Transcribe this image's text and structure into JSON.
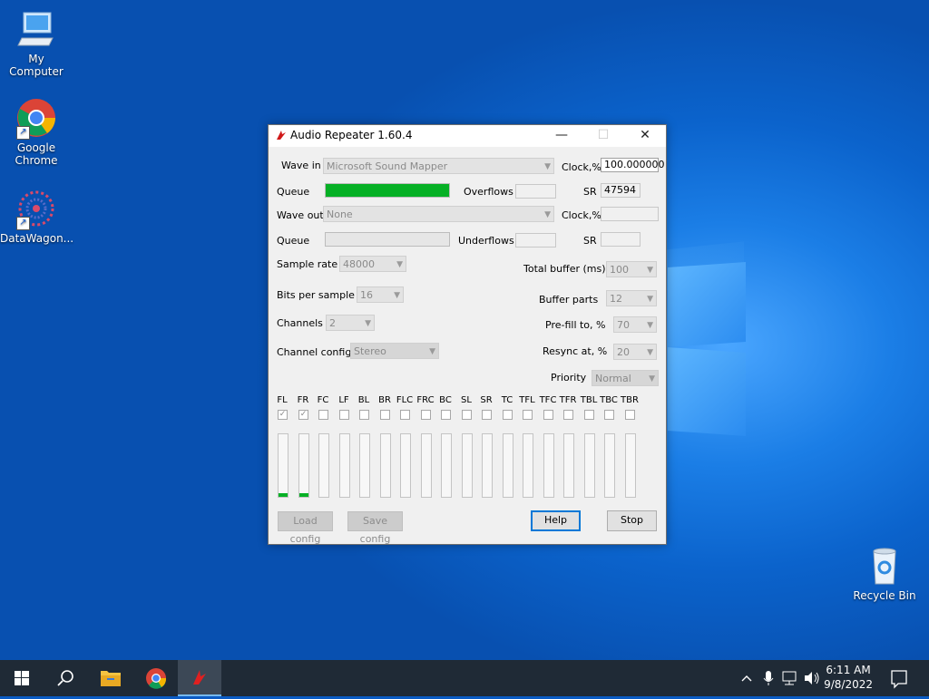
{
  "desktop": {
    "icons": [
      {
        "label_l1": "My Computer",
        "label_l2": ""
      },
      {
        "label_l1": "Google",
        "label_l2": "Chrome"
      },
      {
        "label_l1": "DataWagon...",
        "label_l2": ""
      },
      {
        "label_l1": "Recycle Bin",
        "label_l2": ""
      }
    ]
  },
  "window": {
    "title": "Audio Repeater 1.60.4",
    "min_glyph": "—",
    "max_glyph": "☐",
    "close_glyph": "✕",
    "wave_in": {
      "label": "Wave in",
      "value": "Microsoft Sound Mapper"
    },
    "clock_in": {
      "label": "Clock,%",
      "value": "100.000000"
    },
    "queue_in": {
      "label": "Queue",
      "fill": 1.0
    },
    "overflows": {
      "label": "Overflows",
      "value": ""
    },
    "sr_in": {
      "label": "SR",
      "value": "47594"
    },
    "wave_out": {
      "label": "Wave out",
      "value": "None"
    },
    "clock_out": {
      "label": "Clock,%",
      "value": ""
    },
    "queue_out": {
      "label": "Queue",
      "fill": 0
    },
    "underflows": {
      "label": "Underflows",
      "value": ""
    },
    "sr_out": {
      "label": "SR",
      "value": ""
    },
    "sample_rate": {
      "label": "Sample rate",
      "value": "48000"
    },
    "bits_per_sample": {
      "label": "Bits per sample",
      "value": "16"
    },
    "channels": {
      "label": "Channels",
      "value": "2"
    },
    "channel_config": {
      "label": "Channel config",
      "value": "Stereo"
    },
    "total_buffer": {
      "label": "Total buffer (ms)",
      "value": "100"
    },
    "buffer_parts": {
      "label": "Buffer parts",
      "value": "12"
    },
    "prefill": {
      "label": "Pre-fill to, %",
      "value": "70"
    },
    "resync": {
      "label": "Resync at, %",
      "value": "20"
    },
    "priority": {
      "label": "Priority",
      "value": "Normal"
    },
    "channels_list": [
      {
        "name": "FL",
        "checked": true,
        "level": 0.06
      },
      {
        "name": "FR",
        "checked": true,
        "level": 0.06
      },
      {
        "name": "FC",
        "checked": false,
        "level": 0
      },
      {
        "name": "LF",
        "checked": false,
        "level": 0
      },
      {
        "name": "BL",
        "checked": false,
        "level": 0
      },
      {
        "name": "BR",
        "checked": false,
        "level": 0
      },
      {
        "name": "FLC",
        "checked": false,
        "level": 0
      },
      {
        "name": "FRC",
        "checked": false,
        "level": 0
      },
      {
        "name": "BC",
        "checked": false,
        "level": 0
      },
      {
        "name": "SL",
        "checked": false,
        "level": 0
      },
      {
        "name": "SR",
        "checked": false,
        "level": 0
      },
      {
        "name": "TC",
        "checked": false,
        "level": 0
      },
      {
        "name": "TFL",
        "checked": false,
        "level": 0
      },
      {
        "name": "TFC",
        "checked": false,
        "level": 0
      },
      {
        "name": "TFR",
        "checked": false,
        "level": 0
      },
      {
        "name": "TBL",
        "checked": false,
        "level": 0
      },
      {
        "name": "TBC",
        "checked": false,
        "level": 0
      },
      {
        "name": "TBR",
        "checked": false,
        "level": 0
      }
    ],
    "buttons": {
      "load": "Load config",
      "save": "Save config",
      "help": "Help",
      "stop": "Stop"
    }
  },
  "taskbar": {
    "time": "6:11 AM",
    "date": "9/8/2022",
    "colors": {
      "accent": "#0078d7",
      "meter": "#06b025",
      "taskbar": "#1f2a36"
    }
  }
}
